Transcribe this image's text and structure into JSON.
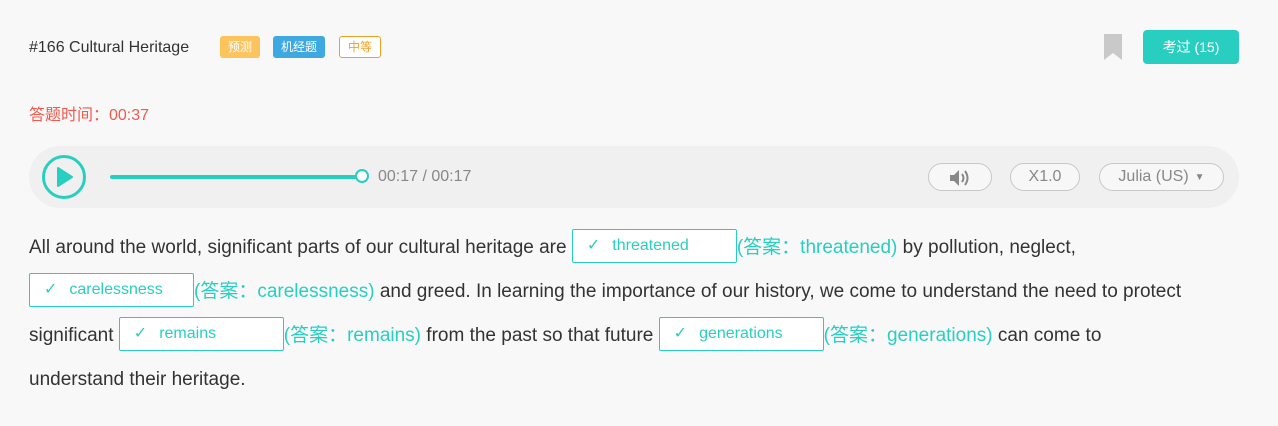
{
  "header": {
    "title": "#166 Cultural Heritage",
    "tags": [
      "预测",
      "机经题",
      "中等"
    ],
    "passed_label": "考过 (15)"
  },
  "timer": "答题时间：00:37",
  "player": {
    "time": "00:17 / 00:17",
    "progress": 1.0,
    "speed": "X1.0",
    "voice": "Julia (US)"
  },
  "passage": {
    "seg1": "All around the world, significant parts of our cultural heritage are",
    "blank1": "threatened",
    "answer1": "(答案：threatened)",
    "seg2": "by pollution, neglect,",
    "blank2": "carelessness",
    "answer2": "(答案：carelessness)",
    "seg3": "and greed. In learning the importance of our history, we come to understand the need to protect",
    "seg4": "significant",
    "blank3": "remains",
    "answer3": "(答案：remains)",
    "seg5": "from the past so that future",
    "blank4": "generations",
    "answer4": "(答案：generations)",
    "seg6": "can come to",
    "seg7": "understand their heritage."
  },
  "colors": {
    "accent": "#28cfc0",
    "timer": "#f05a4f",
    "tag_predict": "#fdc35c",
    "tag_machine": "#3ea8e0",
    "tag_level": "#f0a029"
  },
  "icons": [
    "play-icon",
    "volume-icon",
    "bookmark-icon",
    "check-icon",
    "caret-down-icon"
  ]
}
